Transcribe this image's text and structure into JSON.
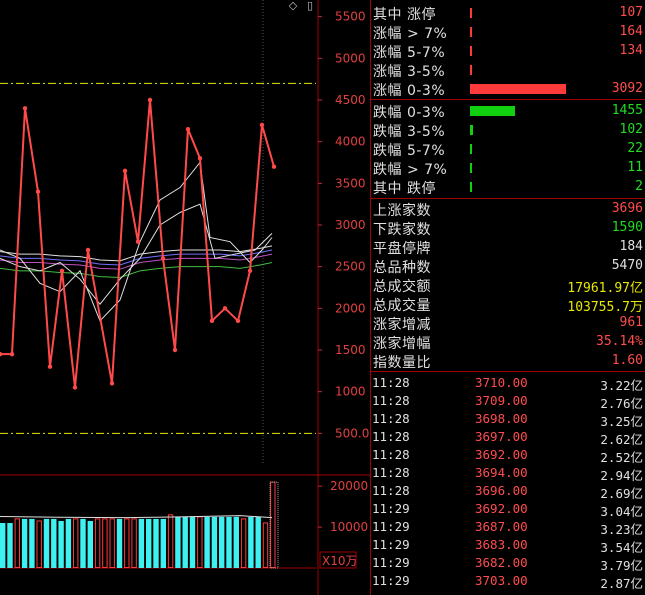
{
  "price_axis": {
    "ticks": [
      "5500",
      "5000",
      "4500",
      "4000",
      "3500",
      "3000",
      "2500",
      "2000",
      "1500",
      "1000",
      "500.0"
    ]
  },
  "volume_axis": {
    "ticks": [
      "20000",
      "10000"
    ],
    "unit": "X10万"
  },
  "breadth": [
    {
      "label": "其中 涨停",
      "value": "107",
      "color": "red",
      "bar": 0.004
    },
    {
      "label": "涨幅 > 7%",
      "value": "164",
      "color": "red",
      "bar": 0.006
    },
    {
      "label": "涨幅 5-7%",
      "value": "134",
      "color": "red",
      "bar": 0.005
    },
    {
      "label": "涨幅 3-5%",
      "value": "",
      "color": "red",
      "bar": 0.012
    },
    {
      "label": "涨幅 0-3%",
      "value": "3092",
      "color": "red",
      "bar": 1.0
    },
    {
      "label": "跌幅 0-3%",
      "value": "1455",
      "color": "green",
      "bar": 0.47
    },
    {
      "label": "跌幅 3-5%",
      "value": "102",
      "color": "green",
      "bar": 0.033
    },
    {
      "label": "跌幅 5-7%",
      "value": "22",
      "color": "green",
      "bar": 0.007
    },
    {
      "label": "跌幅 > 7%",
      "value": "11",
      "color": "green",
      "bar": 0.004
    },
    {
      "label": "其中 跌停",
      "value": "2",
      "color": "green",
      "bar": 0.002
    }
  ],
  "summary": [
    {
      "label": "上涨家数",
      "value": "3696",
      "color": "red"
    },
    {
      "label": "下跌家数",
      "value": "1590",
      "color": "green"
    },
    {
      "label": "平盘停牌",
      "value": "184",
      "color": "white"
    },
    {
      "label": "总品种数",
      "value": "5470",
      "color": "white"
    },
    {
      "label": "总成交额",
      "value": "17961.97亿",
      "color": "yellow"
    },
    {
      "label": "总成交量",
      "value": "103755.7万",
      "color": "yellow"
    },
    {
      "label": "涨家增减",
      "value": "961",
      "color": "red"
    },
    {
      "label": "涨家增幅",
      "value": "35.14%",
      "color": "red"
    },
    {
      "label": "指数量比",
      "value": "1.60",
      "color": "red"
    }
  ],
  "ticks": [
    {
      "time": "11:28",
      "price": "3710.00",
      "amount": "3.22亿"
    },
    {
      "time": "11:28",
      "price": "3709.00",
      "amount": "2.76亿"
    },
    {
      "time": "11:28",
      "price": "3698.00",
      "amount": "3.25亿"
    },
    {
      "time": "11:28",
      "price": "3697.00",
      "amount": "2.62亿"
    },
    {
      "time": "11:28",
      "price": "3692.00",
      "amount": "2.52亿"
    },
    {
      "time": "11:28",
      "price": "3694.00",
      "amount": "2.94亿"
    },
    {
      "time": "11:28",
      "price": "3696.00",
      "amount": "2.69亿"
    },
    {
      "time": "11:29",
      "price": "3692.00",
      "amount": "3.04亿"
    },
    {
      "time": "11:29",
      "price": "3687.00",
      "amount": "3.23亿"
    },
    {
      "time": "11:29",
      "price": "3683.00",
      "amount": "3.54亿"
    },
    {
      "time": "11:29",
      "price": "3682.00",
      "amount": "3.79亿"
    },
    {
      "time": "11:29",
      "price": "3703.00",
      "amount": "2.87亿"
    }
  ],
  "chart_data": {
    "type": "line",
    "ylim": [
      0,
      5700
    ],
    "reference_lines": [
      4700,
      500
    ],
    "series": [
      {
        "values": [
          1450,
          1450,
          4400,
          3400,
          1300,
          2450,
          1050,
          2700,
          1100,
          3650,
          2800,
          4500,
          2600,
          1500,
          4150,
          3800,
          1850,
          2000,
          1850,
          2450,
          4200,
          3700
        ]
      }
    ],
    "volume": {
      "ylim": [
        0,
        22000
      ],
      "values": [
        11000,
        11000,
        12000,
        12000,
        12000,
        11500,
        12000,
        12000,
        11500,
        12000,
        12000,
        12000,
        11500,
        12000,
        12000,
        12000,
        12000,
        12000,
        12000,
        12000,
        12000,
        12000,
        12000,
        13000,
        12500,
        12500,
        12500,
        12500,
        12500,
        12500,
        12500,
        12500,
        12500,
        12000,
        12500,
        12500,
        11000,
        21000
      ],
      "colors": [
        "cyan",
        "cyan",
        "red",
        "cyan",
        "cyan",
        "red",
        "cyan",
        "cyan",
        "cyan",
        "cyan",
        "red",
        "cyan",
        "cyan",
        "red",
        "red",
        "red",
        "cyan",
        "red",
        "red",
        "cyan",
        "cyan",
        "cyan",
        "cyan",
        "red",
        "cyan",
        "cyan",
        "cyan",
        "red",
        "cyan",
        "cyan",
        "cyan",
        "cyan",
        "cyan",
        "red",
        "cyan",
        "cyan",
        "red",
        "red"
      ]
    }
  }
}
